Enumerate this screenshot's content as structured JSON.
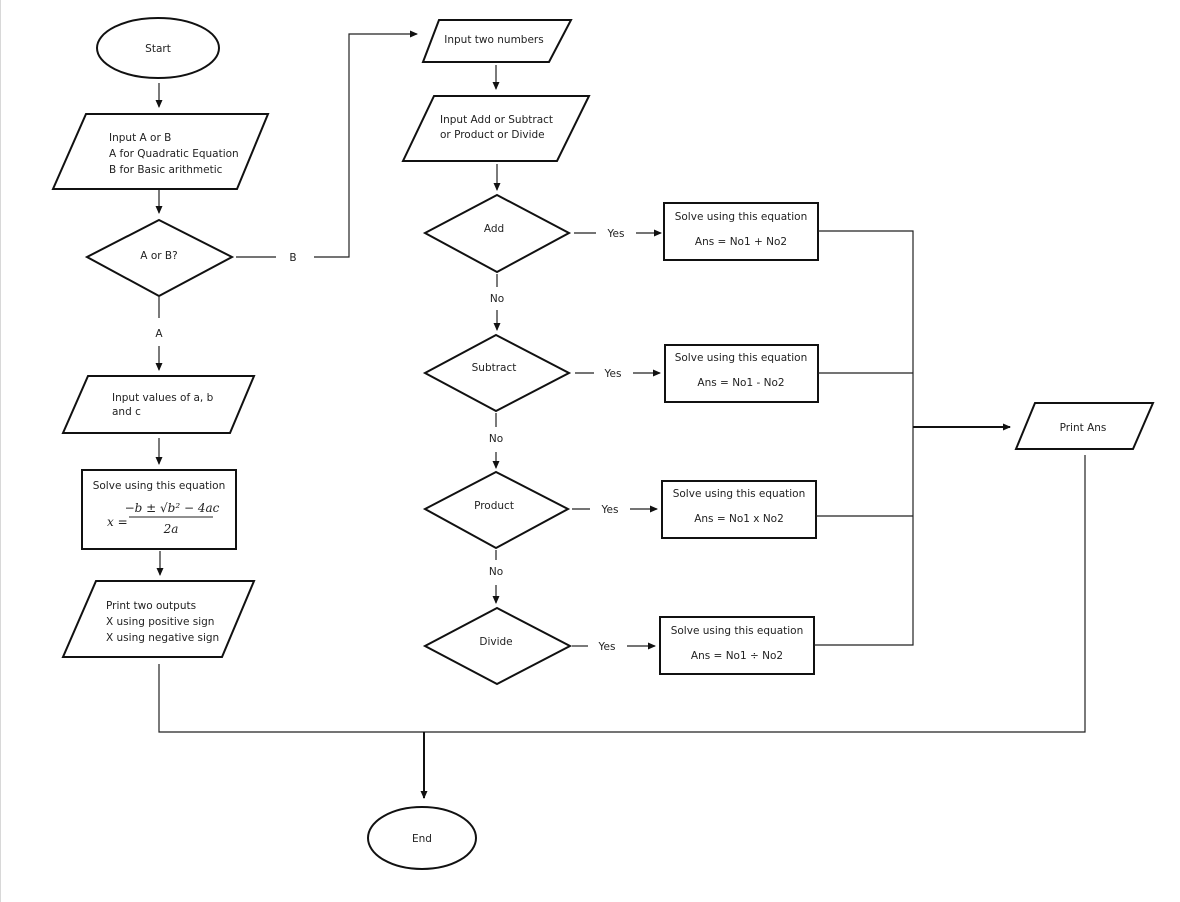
{
  "diagram": {
    "type": "flowchart",
    "nodes": {
      "start": {
        "shape": "terminator",
        "text": [
          "Start"
        ]
      },
      "input_choice": {
        "shape": "io",
        "text": [
          "Input A or B",
          "A for Quadratic Equation",
          "B for Basic arithmetic"
        ]
      },
      "decision_ab": {
        "shape": "decision",
        "text": [
          "A or B?"
        ]
      },
      "input_abc": {
        "shape": "io",
        "text": [
          "Input values of a, b",
          "and c"
        ]
      },
      "solve_quadratic": {
        "shape": "process",
        "text": [
          "Solve using this equation"
        ],
        "formula": {
          "lhs": "x =",
          "numerator": "−b ± √b² − 4ac",
          "denominator": "2a"
        }
      },
      "print_two": {
        "shape": "io",
        "text": [
          "Print two outputs",
          "X using positive sign",
          "X using negative sign"
        ]
      },
      "input_two_numbers": {
        "shape": "io",
        "text": [
          "Input two numbers"
        ]
      },
      "input_operation": {
        "shape": "io",
        "text": [
          "Input Add or Subtract",
          "or Product or Divide"
        ]
      },
      "decision_add": {
        "shape": "decision",
        "text": [
          "Add"
        ]
      },
      "decision_subtract": {
        "shape": "decision",
        "text": [
          "Subtract"
        ]
      },
      "decision_product": {
        "shape": "decision",
        "text": [
          "Product"
        ]
      },
      "decision_divide": {
        "shape": "decision",
        "text": [
          "Divide"
        ]
      },
      "solve_add": {
        "shape": "process",
        "text": [
          "Solve using this equation",
          "Ans = No1 + No2"
        ]
      },
      "solve_subtract": {
        "shape": "process",
        "text": [
          "Solve using this equation",
          "Ans = No1 - No2"
        ]
      },
      "solve_product": {
        "shape": "process",
        "text": [
          "Solve using this equation",
          "Ans = No1 x No2"
        ]
      },
      "solve_divide": {
        "shape": "process",
        "text": [
          "Solve using this equation",
          "Ans = No1 ÷ No2"
        ]
      },
      "print_ans": {
        "shape": "io",
        "text": [
          "Print Ans"
        ]
      },
      "end": {
        "shape": "terminator",
        "text": [
          "End"
        ]
      }
    },
    "edge_labels": {
      "a": "A",
      "b": "B",
      "yes": "Yes",
      "no": "No"
    },
    "edges": [
      {
        "from": "start",
        "to": "input_choice"
      },
      {
        "from": "input_choice",
        "to": "decision_ab"
      },
      {
        "from": "decision_ab",
        "to": "input_abc",
        "label": "A"
      },
      {
        "from": "decision_ab",
        "to": "input_two_numbers",
        "label": "B"
      },
      {
        "from": "input_abc",
        "to": "solve_quadratic"
      },
      {
        "from": "solve_quadratic",
        "to": "print_two"
      },
      {
        "from": "print_two",
        "to": "end"
      },
      {
        "from": "input_two_numbers",
        "to": "input_operation"
      },
      {
        "from": "input_operation",
        "to": "decision_add"
      },
      {
        "from": "decision_add",
        "to": "solve_add",
        "label": "Yes"
      },
      {
        "from": "decision_add",
        "to": "decision_subtract",
        "label": "No"
      },
      {
        "from": "decision_subtract",
        "to": "solve_subtract",
        "label": "Yes"
      },
      {
        "from": "decision_subtract",
        "to": "decision_product",
        "label": "No"
      },
      {
        "from": "decision_product",
        "to": "solve_product",
        "label": "Yes"
      },
      {
        "from": "decision_product",
        "to": "decision_divide",
        "label": "No"
      },
      {
        "from": "decision_divide",
        "to": "solve_divide",
        "label": "Yes"
      },
      {
        "from": "solve_add",
        "to": "print_ans"
      },
      {
        "from": "solve_subtract",
        "to": "print_ans"
      },
      {
        "from": "solve_product",
        "to": "print_ans"
      },
      {
        "from": "solve_divide",
        "to": "print_ans"
      },
      {
        "from": "print_ans",
        "to": "end"
      }
    ]
  }
}
